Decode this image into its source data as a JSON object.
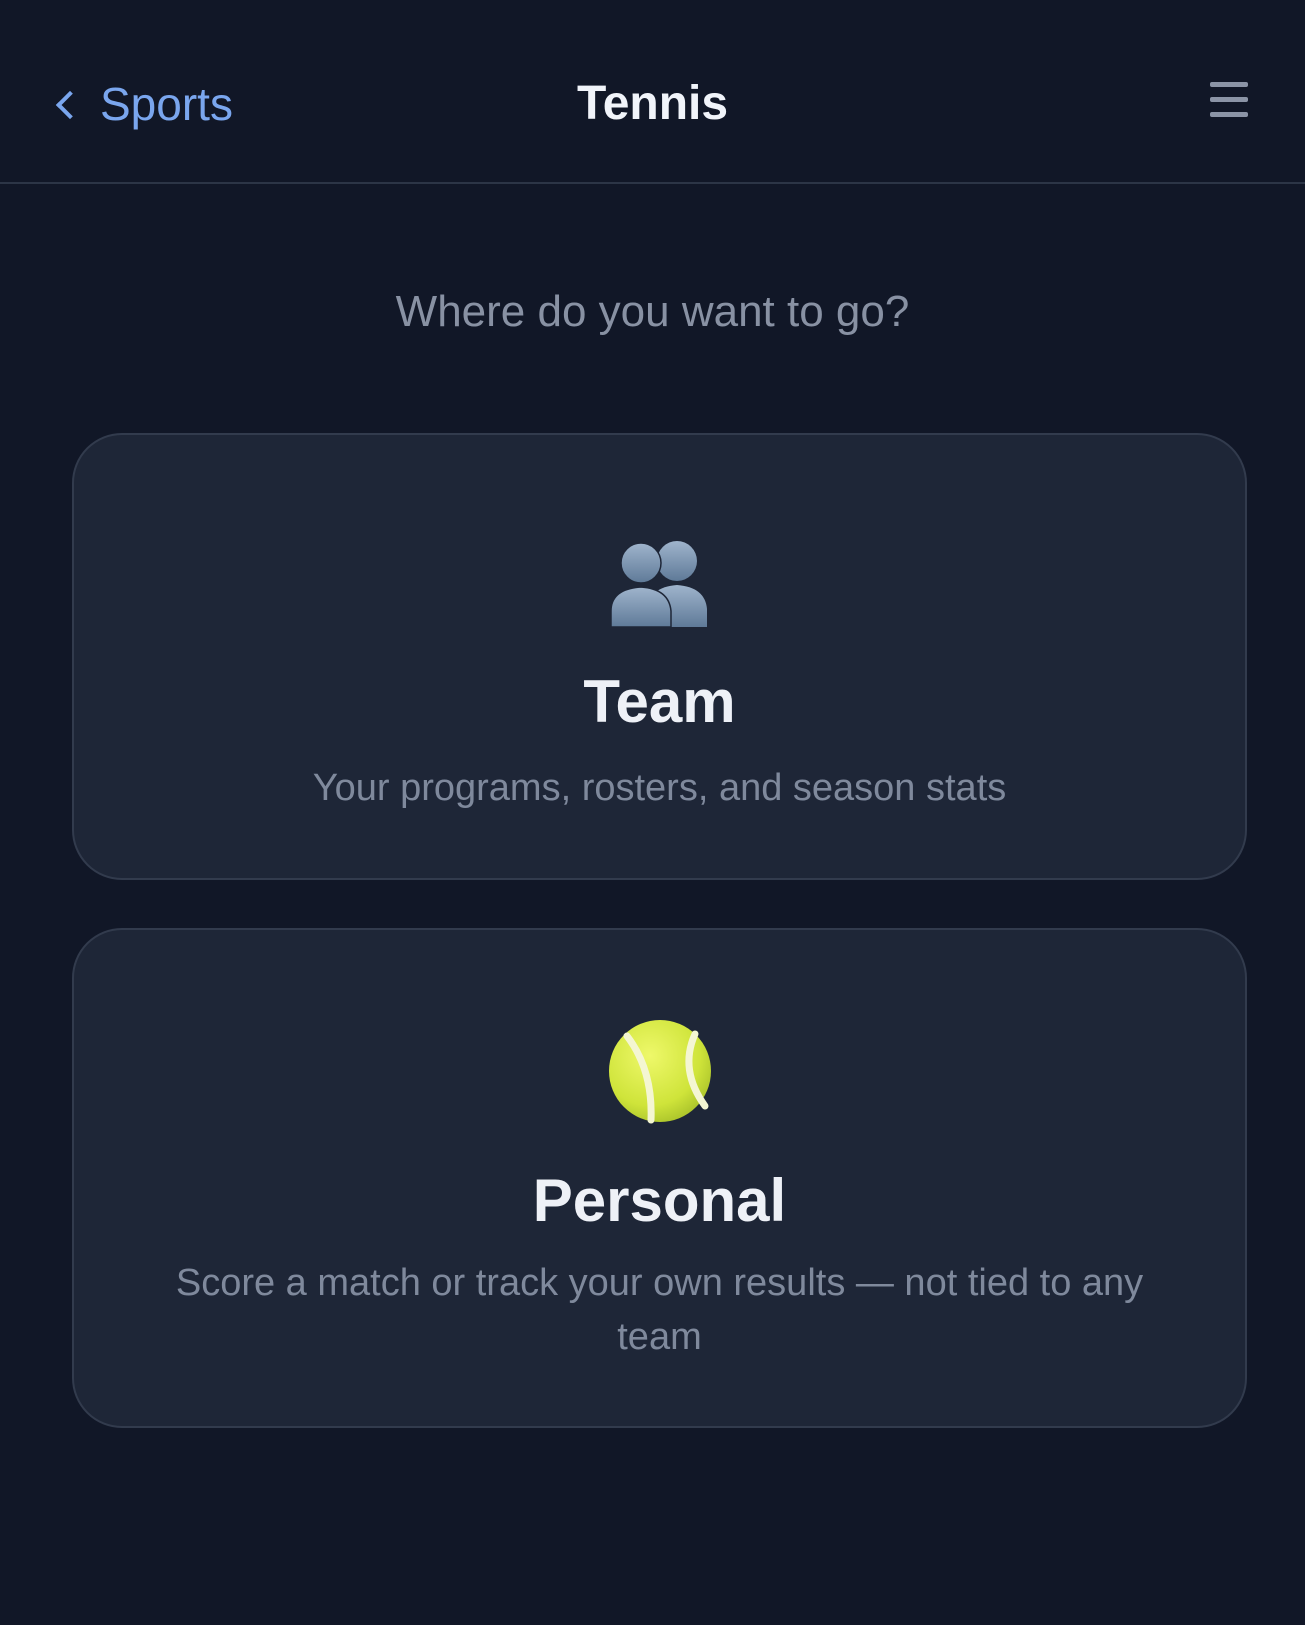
{
  "header": {
    "back_label": "Sports",
    "title": "Tennis",
    "menu_icon": "hamburger-menu-icon"
  },
  "main": {
    "prompt": "Where do you want to go?",
    "options": [
      {
        "icon": "two-people-silhouette-icon",
        "title": "Team",
        "description": "Your programs, rosters, and season stats"
      },
      {
        "icon": "tennis-ball-icon",
        "title": "Personal",
        "description": "Score a match or track your own results — not tied to any team"
      }
    ]
  },
  "colors": {
    "background": "#111727",
    "card": "#1e2637",
    "card_border": "#323b4d",
    "accent_link": "#7aa6ee",
    "title_text": "#eef1f7",
    "muted_text": "#8891a3",
    "tennis_ball": "#d7ec3e"
  }
}
